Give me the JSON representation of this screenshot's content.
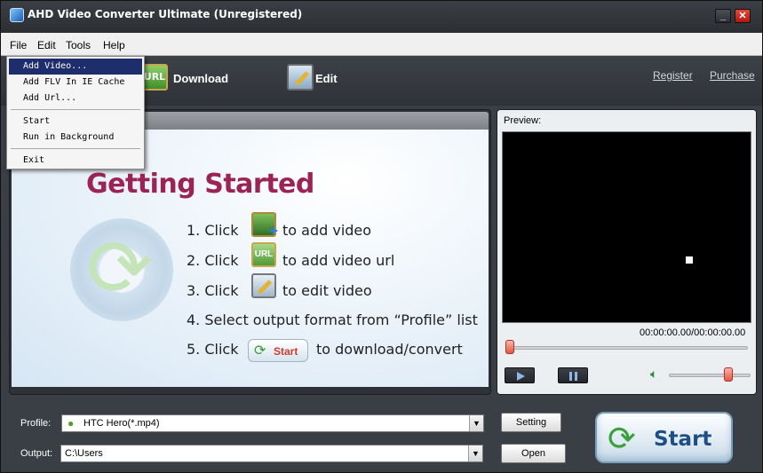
{
  "window": {
    "title": "AHD Video Converter Ultimate (Unregistered)",
    "min_glyph": "_",
    "close_glyph": "✕"
  },
  "menubar": {
    "items": [
      "File",
      "Edit",
      "Tools",
      "Help"
    ]
  },
  "file_menu": {
    "items": [
      "Add Video...",
      "Add FLV In IE Cache",
      "Add Url...",
      "Start",
      "Run in Background",
      "Exit"
    ],
    "active": "Add Video..."
  },
  "toolbar": {
    "url_icon_text": "URL",
    "download_label": "Download",
    "edit_label": "Edit",
    "register_link": "Register",
    "purchase_link": "Purchase"
  },
  "getting_started": {
    "title": "Getting Started",
    "steps": [
      {
        "num": "1. Click",
        "text": "to add video"
      },
      {
        "num": "2. Click",
        "text": "to add video url"
      },
      {
        "num": "3. Click",
        "text": "to edit video"
      },
      {
        "num": "4. Select output format from “Profile” list",
        "text": ""
      },
      {
        "num": "5. Click",
        "text": "to download/convert"
      }
    ],
    "url_icon_text": "URL",
    "mini_start_label": "Start"
  },
  "preview": {
    "label": "Preview:",
    "timecode": "00:00:00.00/00:00:00.00",
    "seek_position": 0.0,
    "volume_level": 0.75
  },
  "bottom": {
    "profile_label": "Profile:",
    "profile_value": "HTC Hero(*.mp4)",
    "output_label": "Output:",
    "output_value": "C:\\Users",
    "setting_button": "Setting",
    "open_button": "Open",
    "start_button": "Start"
  },
  "colors": {
    "title_accent": "#9b2356",
    "menu_highlight": "#1e2d6b",
    "start_label": "#1d4f86"
  },
  "icons": {
    "app": "app-icon",
    "url": "url-icon",
    "edit": "edit-icon",
    "add_video": "add-video-icon",
    "volume": "volume-icon",
    "start": "refresh-icon"
  }
}
